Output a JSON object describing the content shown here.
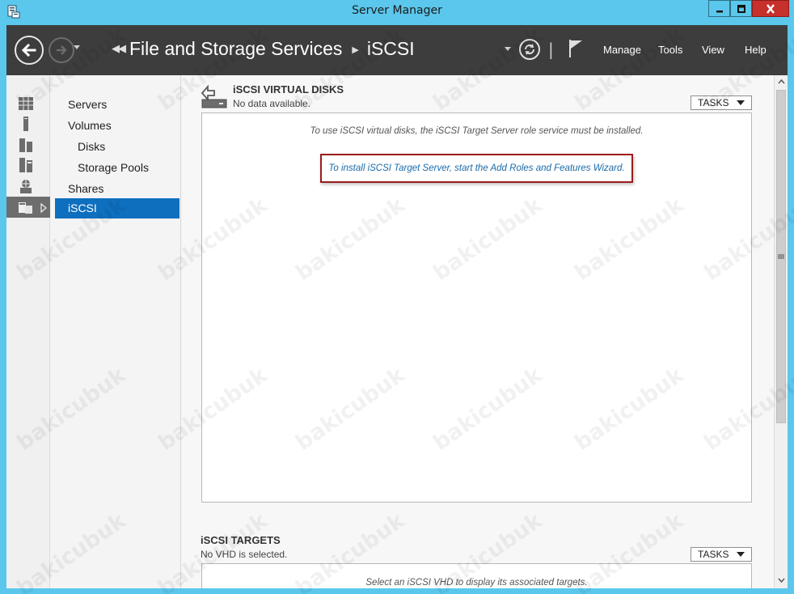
{
  "window": {
    "title": "Server Manager"
  },
  "header": {
    "breadcrumb_root": "File and Storage Services",
    "breadcrumb_current": "iSCSI",
    "menu": {
      "manage": "Manage",
      "tools": "Tools",
      "view": "View",
      "help": "Help"
    }
  },
  "icon_column": {
    "icons": [
      "dashboard-icon",
      "local-server-icon",
      "all-servers-icon",
      "file-services-icon",
      "iis-icon",
      "storage-icon"
    ]
  },
  "sidebar": {
    "items": [
      {
        "label": "Servers"
      },
      {
        "label": "Volumes"
      },
      {
        "label": "Disks"
      },
      {
        "label": "Storage Pools"
      },
      {
        "label": "Shares"
      },
      {
        "label": "iSCSI"
      }
    ]
  },
  "virtual_disks": {
    "title": "iSCSI VIRTUAL DISKS",
    "subtitle": "No data available.",
    "tasks_label": "TASKS",
    "message": "To use iSCSI virtual disks, the iSCSI Target Server role service must be installed.",
    "wizard_link": "To install iSCSI Target Server, start the Add Roles and Features Wizard."
  },
  "targets": {
    "title": "iSCSI TARGETS",
    "subtitle": "No VHD is selected.",
    "tasks_label": "TASKS",
    "message": "Select an iSCSI VHD to display its associated targets."
  },
  "watermark": "bakicubuk",
  "colors": {
    "title_bar": "#5bc7ec",
    "header": "#3d3d3d",
    "selected": "#0e6fbe",
    "close_button": "#c7302b",
    "highlight_border": "#9b1c1c",
    "link": "#1a6aa8"
  }
}
